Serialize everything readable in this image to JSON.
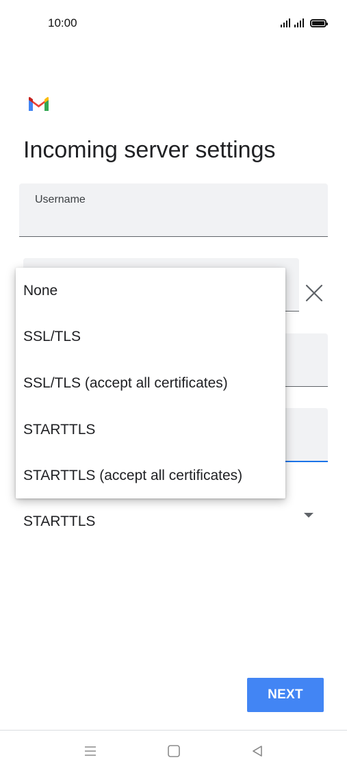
{
  "status_bar": {
    "time": "10:00",
    "icons": [
      "signal-icon",
      "signal-icon",
      "battery-icon"
    ]
  },
  "app": {
    "logo": "gmail-logo",
    "title": "Incoming server settings"
  },
  "form": {
    "username_label": "Username",
    "security_type_value": "STARTTLS"
  },
  "security_menu": {
    "options": [
      "None",
      "SSL/TLS",
      "SSL/TLS (accept all certificates)",
      "STARTTLS",
      "STARTTLS (accept all certificates)"
    ]
  },
  "actions": {
    "next_label": "NEXT"
  },
  "nav": {
    "icons": [
      "menu-icon",
      "home-icon",
      "back-icon"
    ]
  },
  "colors": {
    "accent": "#4285f4",
    "focus": "#1a73e8",
    "field_bg": "#f1f2f4"
  }
}
